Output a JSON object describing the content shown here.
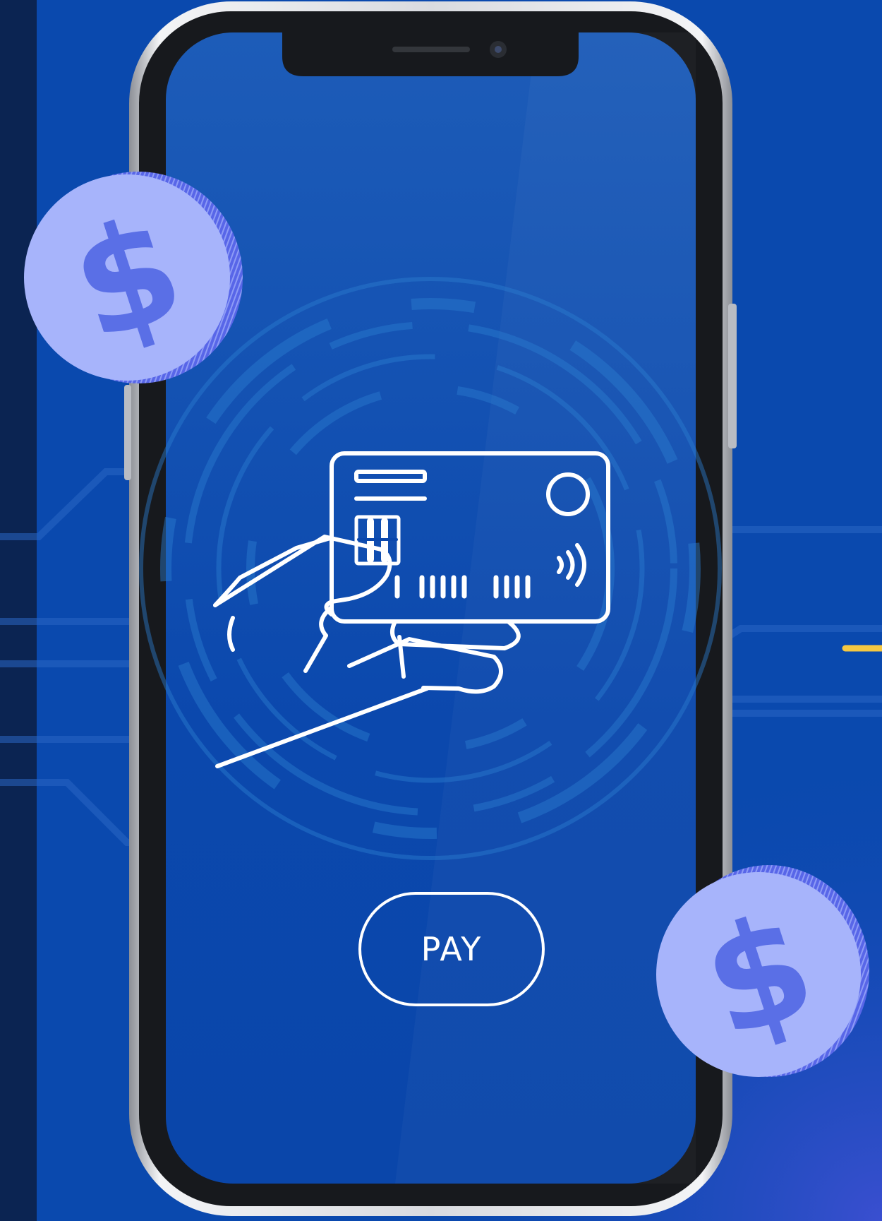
{
  "pay_button": {
    "label": "PAY"
  },
  "coin_symbol": "$",
  "icons": [
    "hand-holding-card-icon",
    "contactless-icon",
    "card-chip-icon",
    "dollar-coin-icon"
  ],
  "colors": {
    "background": "#0a49ae",
    "left_strip": "#0b2452",
    "screen": "#0b48ad",
    "coin_face": "#a7b4fb",
    "coin_symbol": "#5a6fe6",
    "accent_yellow": "#f5c842",
    "line_art": "#ffffff"
  }
}
